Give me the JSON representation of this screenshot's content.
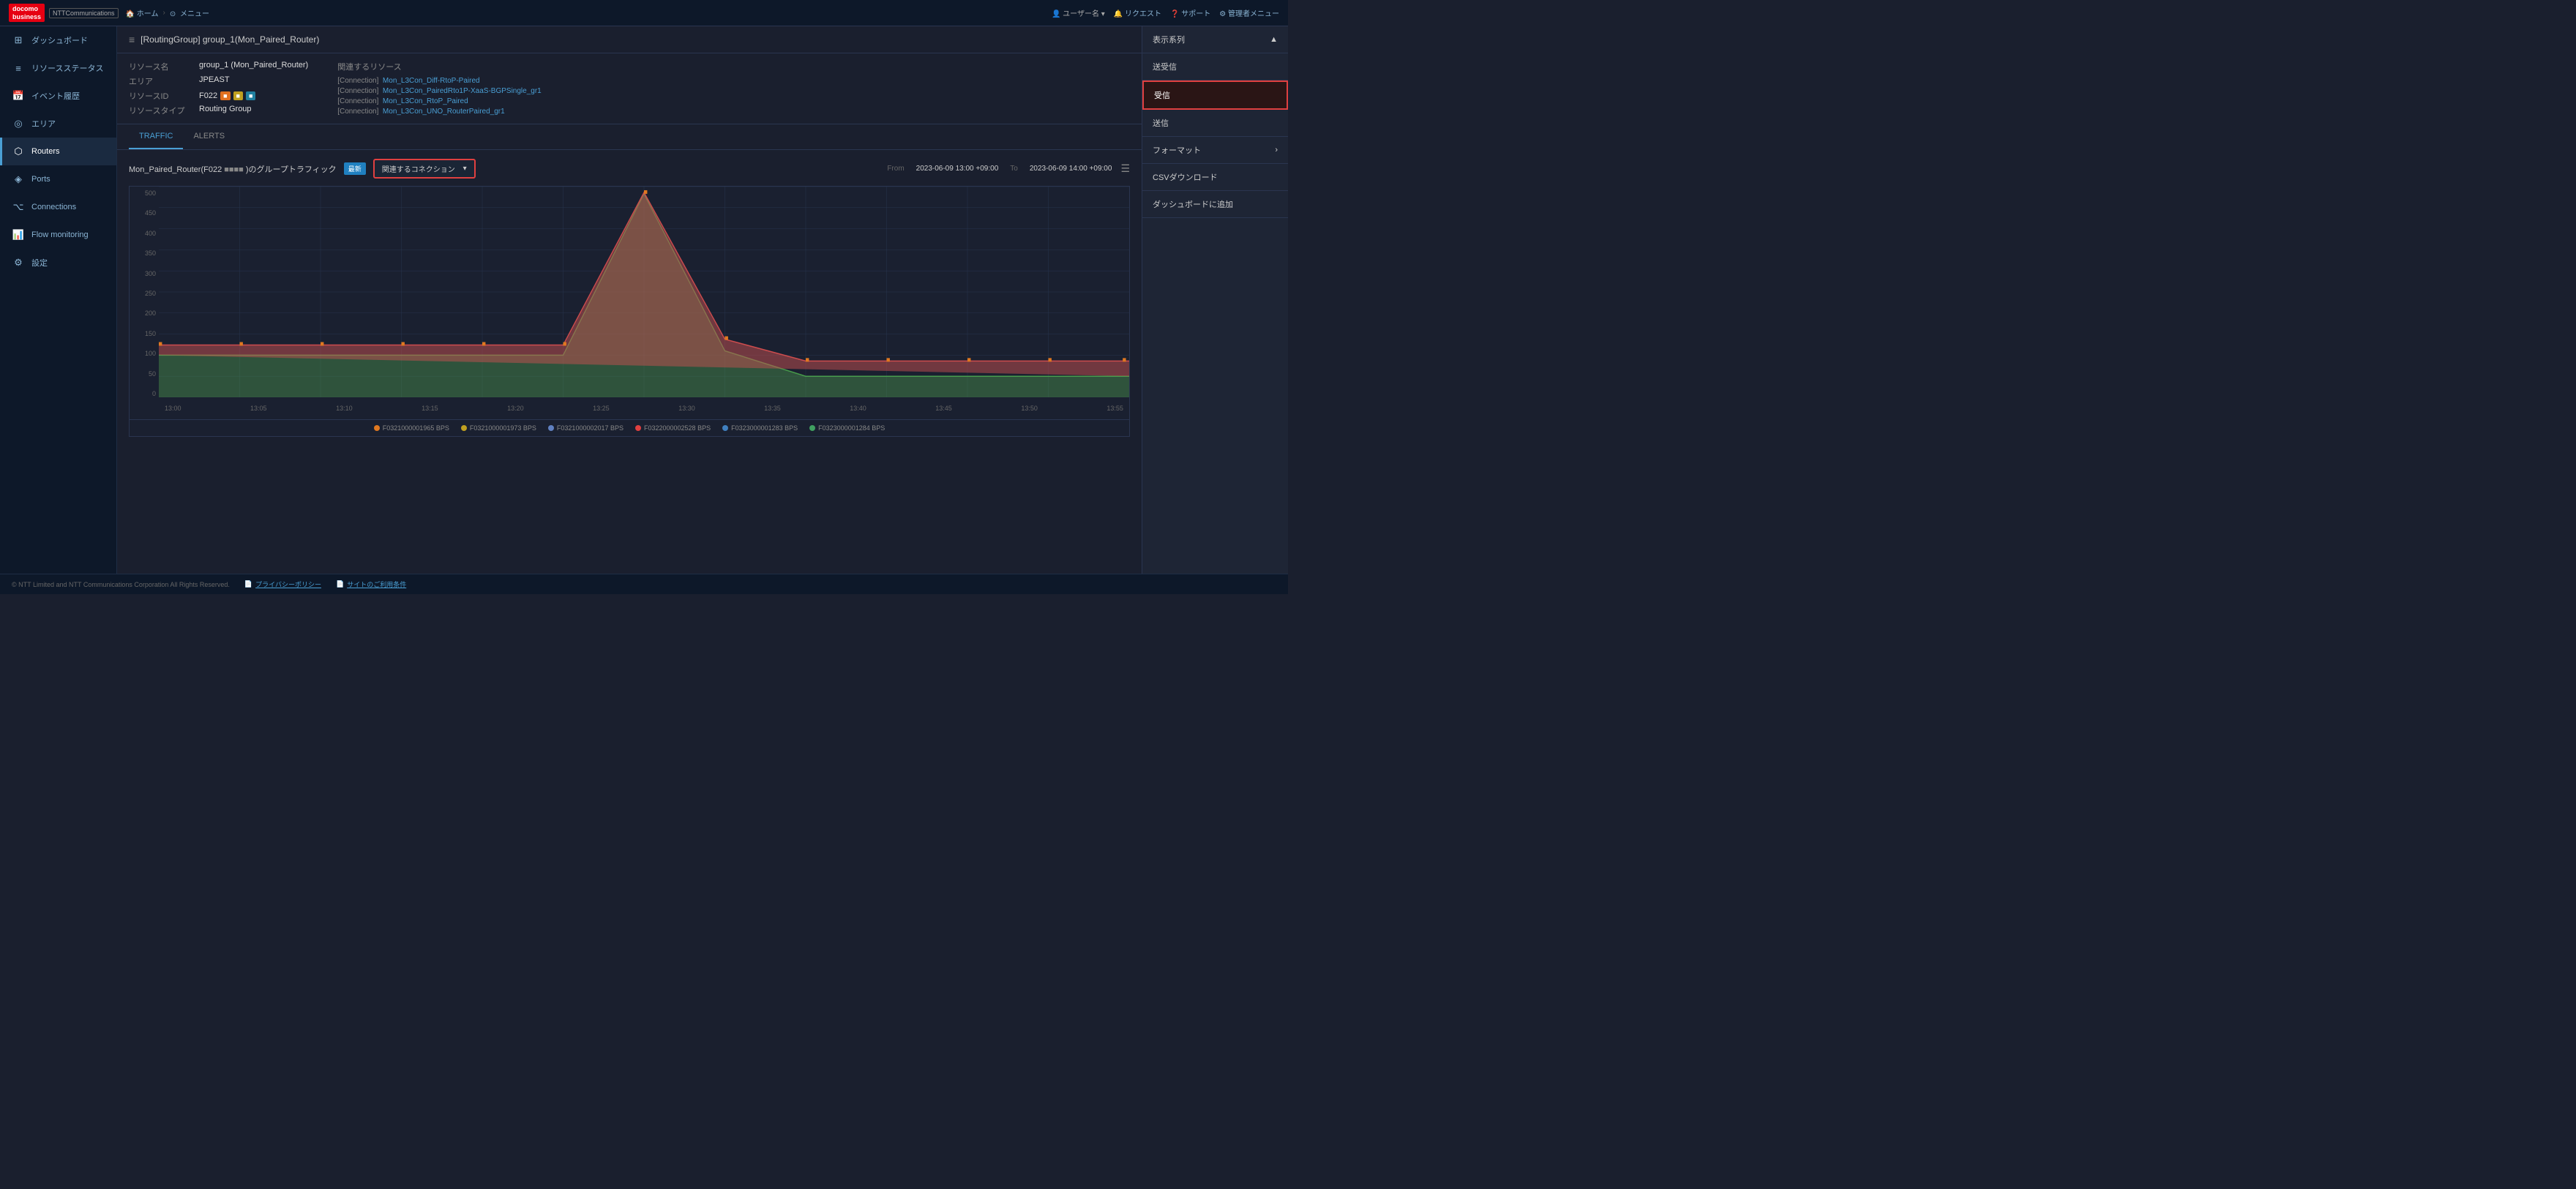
{
  "topbar": {
    "logo_docomo": "docomo\nbusiness",
    "logo_ntt": "NTTCommunications",
    "breadcrumb_home": "ホーム",
    "breadcrumb_separator": "›",
    "breadcrumb_menu": "メニュー",
    "user_info": "ユーザー名",
    "nav_request": "リクエスト",
    "nav_support": "サポート",
    "nav_admin": "管理者メニュー"
  },
  "sidebar": {
    "items": [
      {
        "id": "dashboard",
        "label": "ダッシュボード",
        "icon": "⊞"
      },
      {
        "id": "resource-status",
        "label": "リソースステータス",
        "icon": "≡"
      },
      {
        "id": "event-history",
        "label": "イベント履歴",
        "icon": "📅"
      },
      {
        "id": "area",
        "label": "エリア",
        "icon": "◎"
      },
      {
        "id": "routers",
        "label": "Routers",
        "icon": "⬡"
      },
      {
        "id": "ports",
        "label": "Ports",
        "icon": "⬟"
      },
      {
        "id": "connections",
        "label": "Connections",
        "icon": "⌥"
      },
      {
        "id": "flow-monitoring",
        "label": "Flow monitoring",
        "icon": "📊"
      },
      {
        "id": "settings",
        "label": "設定",
        "icon": "⚙"
      }
    ]
  },
  "page_header": {
    "breadcrumb_icon": "≡",
    "title": "[RoutingGroup] group_1(Mon_Paired_Router)"
  },
  "resource_info": {
    "resource_name_label": "リソース名",
    "resource_name_value": "group_1 (Mon_Paired_Router)",
    "area_label": "エリア",
    "area_value": "JPEAST",
    "resource_id_label": "リソースID",
    "resource_id_value": "F022",
    "resource_type_label": "リソースタイプ",
    "resource_type_value": "Routing Group",
    "related_title": "関連するリソース",
    "related_items": [
      {
        "tag": "[Connection]",
        "name": "Mon_L3Con_Diff-RtoP-Paired"
      },
      {
        "tag": "[Connection]",
        "name": "Mon_L3Con_PairedRto1P-XaaS-BGPSingle_gr1"
      },
      {
        "tag": "[Connection]",
        "name": "Mon_L3Con_RtoP_Paired"
      },
      {
        "tag": "[Connection]",
        "name": "Mon_L3Con_UNO_RouterPaired_gr1"
      }
    ]
  },
  "tabs": {
    "traffic": "TRAFFIC",
    "alerts": "ALERTS",
    "active": "TRAFFIC"
  },
  "chart": {
    "title": "Mon_Paired_Router(F022",
    "title_suffix": ")のグループトラフィック",
    "live_label": "最新",
    "connection_dropdown_label": "関連するコネクション",
    "time_from_label": "From",
    "time_to_label": "To",
    "time_from_value": "2023-06-09 13:00 +09:00",
    "time_to_value": "2023-06-09 14:00 +09:00",
    "y_axis_values": [
      "500",
      "450",
      "400",
      "350",
      "300",
      "250",
      "200",
      "150",
      "100",
      "50",
      "0"
    ],
    "x_axis_values": [
      "13:00",
      "13:05",
      "13:10",
      "13:15",
      "13:20",
      "13:25",
      "13:30",
      "13:35",
      "13:40",
      "13:45",
      "13:50",
      "13:55"
    ],
    "legend_items": [
      {
        "id": "F0321000001965",
        "label": "F0321000001965 BPS",
        "color": "#e07820"
      },
      {
        "id": "F0321000001973",
        "label": "F0321000001973 BPS",
        "color": "#c0a020"
      },
      {
        "id": "F0321000002017",
        "label": "F0321000002017 BPS",
        "color": "#6080c0"
      },
      {
        "id": "F0322000002528",
        "label": "F0322000002528 BPS",
        "color": "#e04040"
      },
      {
        "id": "F0323000001283",
        "label": "F0323000001283 BPS",
        "color": "#4080c0"
      },
      {
        "id": "F0323000001284",
        "label": "F0323000001284 BPS",
        "color": "#40a060"
      }
    ]
  },
  "right_panel": {
    "display_series_label": "表示系列",
    "send_receive_label": "送受信",
    "receive_label": "受信",
    "send_label": "送信",
    "format_label": "フォーマット",
    "csv_download_label": "CSVダウンロード",
    "add_dashboard_label": "ダッシュボードに追加"
  },
  "footer": {
    "copyright": "© NTT Limited and NTT Communications Corporation All Rights Reserved.",
    "privacy_policy": "プライバシーポリシー",
    "terms_of_use": "サイトのご利用条件"
  }
}
